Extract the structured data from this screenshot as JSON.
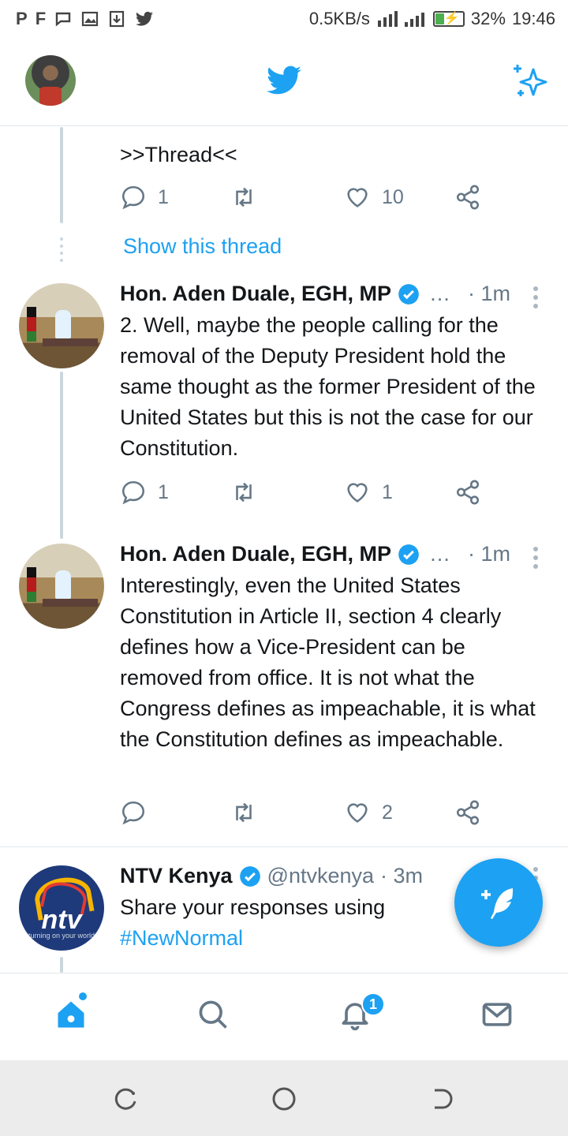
{
  "status_bar": {
    "left_icons": [
      "P",
      "F",
      "chat-bubble-icon",
      "image-icon",
      "download-icon",
      "twitter-bird-icon"
    ],
    "speed": "0.5KB/s",
    "battery_percent": "32%",
    "battery_level": 0.32,
    "time": "19:46"
  },
  "header": {
    "profile_avatar": "profile-avatar",
    "logo_icon": "twitter-bird-icon",
    "action_icon": "sparkle-icon"
  },
  "colors": {
    "accent": "#1da1f2",
    "text_primary": "#14171a",
    "text_secondary": "#657786",
    "divider": "#e1e8ed",
    "thread_line": "#ccd6dd"
  },
  "tweets": [
    {
      "text": ">>Thread<<",
      "replies": "1",
      "retweets": "",
      "likes": "10",
      "show_thread_label": "Show this thread"
    },
    {
      "author": "Hon. Aden Duale, EGH, MP",
      "ellipsis": "…",
      "time": "· 1m",
      "text": "2. Well, maybe the people calling for the removal of the Deputy President hold the same thought as the former President of the United States but this is not the case for our Constitution.",
      "replies": "1",
      "retweets": "",
      "likes": "1"
    },
    {
      "author": "Hon. Aden Duale, EGH, MP",
      "ellipsis": "…",
      "time": "· 1m",
      "text": "Interestingly, even the United States Constitution in Article II, section 4 clearly defines how a Vice-President can be removed from office. It is not what the Congress defines as impeachable, it is what the Constitution defines as impeachable.",
      "replies": "",
      "retweets": "",
      "likes": "2"
    },
    {
      "author": "NTV Kenya",
      "handle": "@ntvkenya",
      "time": "· 3m",
      "text": "Share your responses using",
      "hashtag": "#NewNormal",
      "avatar_logo": "ntv",
      "avatar_tagline": "turning on your world"
    }
  ],
  "bottom_nav": {
    "items": [
      "home-icon",
      "search-icon",
      "notifications-icon",
      "messages-icon"
    ],
    "notification_count": "1"
  },
  "system_nav": [
    "recent-apps-icon",
    "home-circle-icon",
    "back-icon"
  ]
}
